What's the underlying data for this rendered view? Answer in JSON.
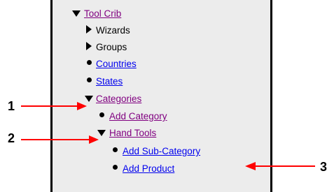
{
  "tree": {
    "items": [
      {
        "label": "Tool Crib",
        "kind": "link-visited",
        "icon": "expanded-triangle-icon"
      },
      {
        "label": "Wizards",
        "kind": "plain",
        "icon": "collapsed-triangle-icon"
      },
      {
        "label": "Groups",
        "kind": "plain",
        "icon": "collapsed-triangle-icon"
      },
      {
        "label": "Countries",
        "kind": "link",
        "icon": "bullet-icon"
      },
      {
        "label": "States",
        "kind": "link",
        "icon": "bullet-icon"
      },
      {
        "label": "Categories",
        "kind": "link-visited",
        "icon": "expanded-triangle-icon"
      },
      {
        "label": "Add Category",
        "kind": "link-visited",
        "icon": "bullet-icon"
      },
      {
        "label": "Hand Tools",
        "kind": "link-visited",
        "icon": "expanded-triangle-icon"
      },
      {
        "label": "Add Sub-Category",
        "kind": "link",
        "icon": "bullet-icon"
      },
      {
        "label": "Add Product",
        "kind": "link",
        "icon": "bullet-icon"
      }
    ]
  },
  "callouts": [
    {
      "number": "1"
    },
    {
      "number": "2"
    },
    {
      "number": "3"
    }
  ],
  "colors": {
    "link": "#0000ee",
    "visited_link": "#800080",
    "panel_background": "#ececec",
    "callout_arrow": "#ff0000"
  }
}
